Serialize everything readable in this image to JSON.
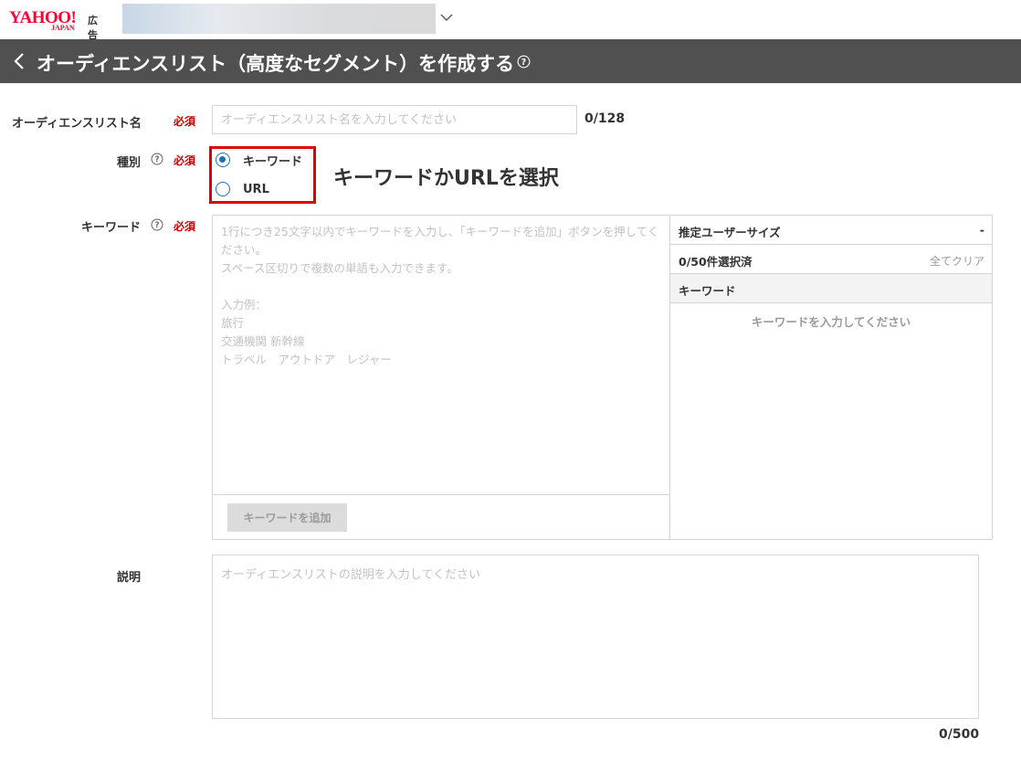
{
  "header": {
    "logo_text": "YAHOO!",
    "logo_sub": "JAPAN",
    "logo_ad": "広告",
    "account_icon": "chevron-down-icon"
  },
  "titlebar": {
    "title": "オーディエンスリスト（高度なセグメント）を作成する",
    "back_icon": "chevron-left-icon",
    "help_icon": "question-circle-icon"
  },
  "form": {
    "required_label": "必須",
    "list_name": {
      "label": "オーディエンスリスト名",
      "placeholder": "オーディエンスリスト名を入力してください",
      "value": "",
      "counter": "0/128"
    },
    "type": {
      "label": "種別",
      "options": [
        {
          "label": "キーワード",
          "selected": true
        },
        {
          "label": "URL",
          "selected": false
        }
      ],
      "annotation": "キーワードかURLを選択",
      "highlight_color": "#e00000"
    },
    "keyword": {
      "label": "キーワード",
      "placeholder": "1行につき25文字以内でキーワードを入力し、「キーワードを追加」ボタンを押してください。\nスペース区切りで複数の単語も入力できます。\n\n入力例：\n旅行\n交通機関 新幹線\nトラベル　アウトドア　レジャー",
      "add_button": "キーワードを追加",
      "estimated_user_size_label": "推定ユーザーサイズ",
      "estimated_user_size_value": "-",
      "selected_count": "0/50件選択済",
      "clear_all": "全てクリア",
      "column_header": "キーワード",
      "empty_message": "キーワードを入力してください"
    },
    "description": {
      "label": "説明",
      "placeholder": "オーディエンスリストの説明を入力してください",
      "value": "",
      "counter": "0/500"
    }
  },
  "colors": {
    "titlebar_bg": "#505050",
    "required_text": "#cc0000",
    "radio_accent": "#1c6fb8",
    "brand_red": "#ff0033"
  }
}
